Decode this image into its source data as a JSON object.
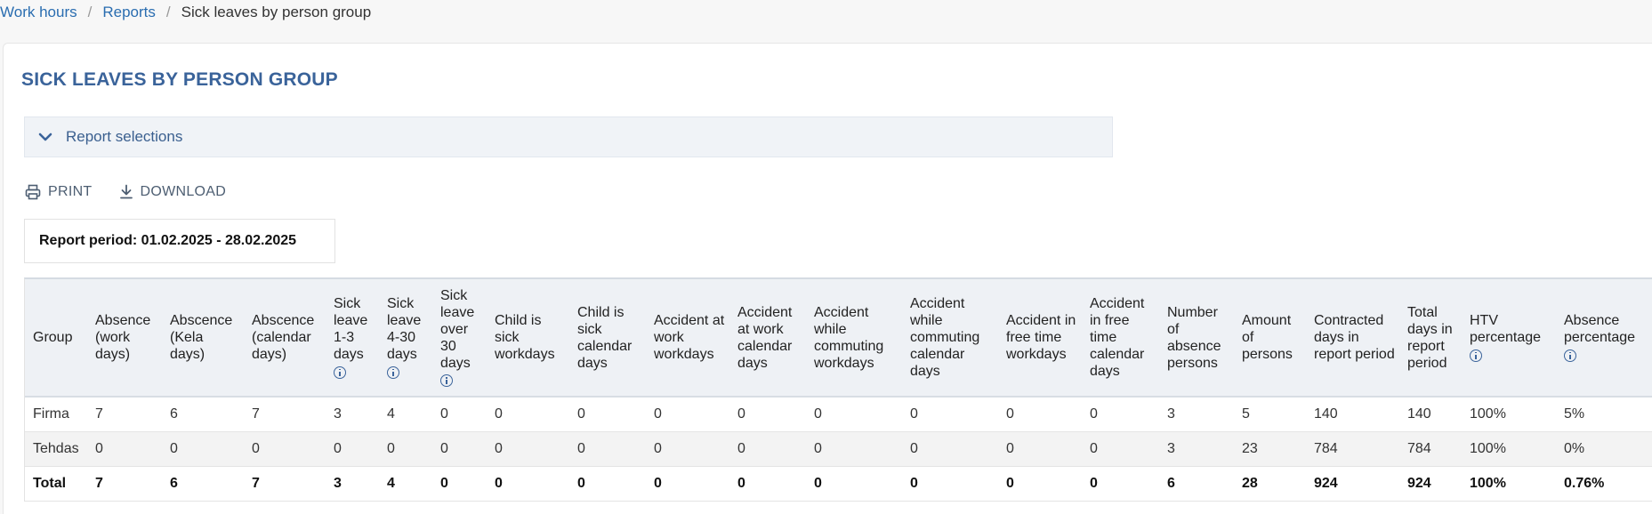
{
  "breadcrumb": {
    "items": [
      "Work hours",
      "Reports"
    ],
    "current": "Sick leaves by person group"
  },
  "page": {
    "title": "SICK LEAVES BY PERSON GROUP"
  },
  "selections": {
    "label": "Report selections",
    "icon": "chevron-down-icon"
  },
  "actions": {
    "print_label": "PRINT",
    "download_label": "DOWNLOAD"
  },
  "period": {
    "text": "Report period: 01.02.2025 - 28.02.2025"
  },
  "colors": {
    "accent": "#3a639a",
    "link": "#2a6db0",
    "header_bg": "#eef1f5"
  },
  "table": {
    "headers": [
      "Group",
      "Absence (work days)",
      "Abscence (Kela days)",
      "Abscence (calendar days)",
      "Sick leave 1-3 days",
      "Sick leave 4-30 days",
      "Sick leave over 30 days",
      "Child is sick workdays",
      "Child is sick calendar days",
      "Accident at work workdays",
      "Accident at work calendar days",
      "Accident while commuting workdays",
      "Accident while commuting calendar days",
      "Accident in free time workdays",
      "Accident in free time calendar days",
      "Number of absence persons",
      "Amount of persons",
      "Contracted days in report period",
      "Total days in report period",
      "HTV percentage",
      "Absence percentage"
    ],
    "rows": [
      [
        "Firma",
        "7",
        "6",
        "7",
        "3",
        "4",
        "0",
        "0",
        "0",
        "0",
        "0",
        "0",
        "0",
        "0",
        "0",
        "3",
        "5",
        "140",
        "140",
        "100%",
        "5%"
      ],
      [
        "Tehdas",
        "0",
        "0",
        "0",
        "0",
        "0",
        "0",
        "0",
        "0",
        "0",
        "0",
        "0",
        "0",
        "0",
        "0",
        "3",
        "23",
        "784",
        "784",
        "100%",
        "0%"
      ],
      [
        "Total",
        "7",
        "6",
        "7",
        "3",
        "4",
        "0",
        "0",
        "0",
        "0",
        "0",
        "0",
        "0",
        "0",
        "0",
        "6",
        "28",
        "924",
        "924",
        "100%",
        "0.76%"
      ]
    ]
  }
}
